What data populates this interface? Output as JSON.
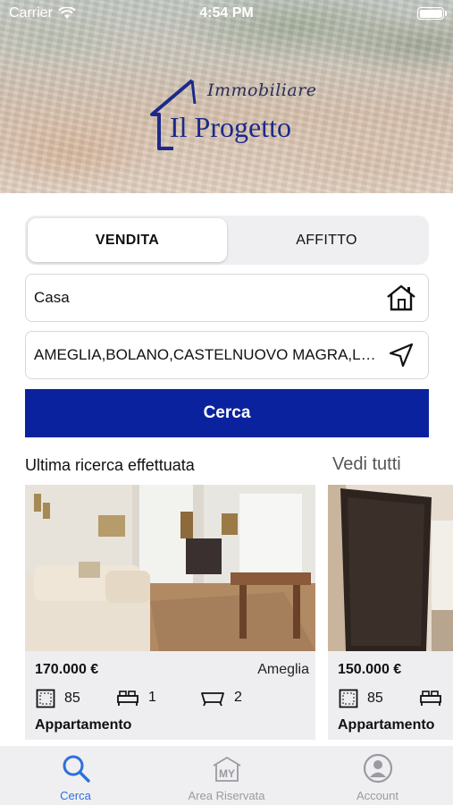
{
  "status": {
    "carrier": "Carrier",
    "time": "4:54 PM"
  },
  "logo": {
    "script": "Immobiliare",
    "name": "Il Progetto"
  },
  "segment": {
    "sale": "VENDITA",
    "rent": "AFFITTO",
    "selected": "VENDITA"
  },
  "search": {
    "property_type": "Casa",
    "property_type_icon": "home-icon",
    "locations": "AMEGLIA,BOLANO,CASTELNUOVO MAGRA,LERICI,LUNI",
    "locations_icon": "location-arrow-icon",
    "button_label": "Cerca"
  },
  "recent": {
    "title": "Ultima ricerca effettuata",
    "see_all": "Vedi tutti"
  },
  "listings": [
    {
      "price": "170.000 €",
      "town": "Ameglia",
      "sqm": "85",
      "bedrooms": "1",
      "bathrooms": "2",
      "type": "Appartamento"
    },
    {
      "price": "150.000 €",
      "town": "",
      "sqm": "85",
      "bedrooms": "",
      "bathrooms": "",
      "type": "Appartamento"
    }
  ],
  "tabbar": {
    "items": [
      {
        "label": "Cerca",
        "icon": "search-icon",
        "active": true
      },
      {
        "label": "Area Riservata",
        "icon": "my-house-icon",
        "active": false
      },
      {
        "label": "Account",
        "icon": "user-circle-icon",
        "active": false
      }
    ]
  },
  "colors": {
    "primary": "#0b229f",
    "tab_active": "#2f6fd9",
    "logo_blue": "#1b2a8a"
  }
}
